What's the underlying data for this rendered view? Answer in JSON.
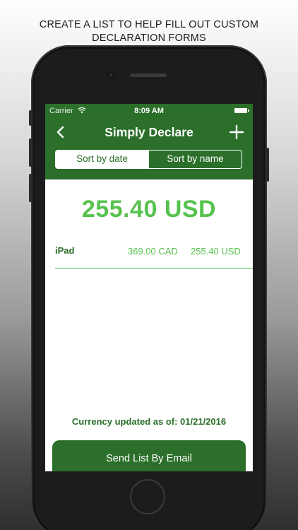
{
  "caption": {
    "line1": "CREATE A LIST TO HELP FILL OUT CUSTOM",
    "line2": "DECLARATION FORMS"
  },
  "status_bar": {
    "carrier": "Carrier",
    "time": "8:09 AM"
  },
  "nav": {
    "title": "Simply Declare",
    "back_icon": "chevron-left-icon",
    "add_icon": "plus-icon"
  },
  "sort": {
    "by_date": "Sort by date",
    "by_name": "Sort by name",
    "selected": "Sort by date"
  },
  "total": {
    "amount": "255.40 USD"
  },
  "items": [
    {
      "name": "iPad",
      "cad": "369.00 CAD",
      "usd": "255.40 USD"
    }
  ],
  "footer": {
    "currency_updated": "Currency updated as of: 01/21/2016",
    "email_button": "Send List By Email"
  },
  "colors": {
    "brand_green": "#2b6f2a",
    "accent_green": "#57c24e",
    "background": "#ffffff"
  }
}
